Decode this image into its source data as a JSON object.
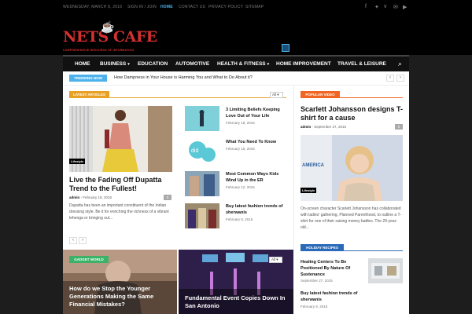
{
  "topbar": {
    "date": "WEDNESDAY, MARCH 8, 2016",
    "links": [
      "SIGN IN / JOIN",
      "HOME",
      "CONTACT US",
      "PRIVACY POLICY",
      "SITEMAP"
    ]
  },
  "header": {
    "logo_text": "NETS CAFE",
    "tagline": "COMPREHENSIVE RESOURCE OF INFORMATION"
  },
  "nav": {
    "items": [
      {
        "label": "HOME",
        "caret": ""
      },
      {
        "label": "BUSINESS",
        "caret": "▾"
      },
      {
        "label": "EDUCATION",
        "caret": ""
      },
      {
        "label": "AUTOMOTIVE",
        "caret": ""
      },
      {
        "label": "HEALTH & FITNESS",
        "caret": "▾"
      },
      {
        "label": "HOME IMPROVEMENT",
        "caret": ""
      },
      {
        "label": "TRAVEL & LEISURE",
        "caret": ""
      }
    ]
  },
  "trending": {
    "label": "TRENDING NOW",
    "text": "How Dampness in Your House is Harming You and What to Do About it?"
  },
  "latest": {
    "label": "LATEST ARTICLES",
    "filter": "All",
    "featured": {
      "category": "Lifestyle",
      "title": "Live the Fading Off Dupatta Trend to the Fullest!",
      "author": "admin",
      "date": "February 18, 2016",
      "comments": "0",
      "excerpt": "Dupatta has been an important constituent of the Indian dressing style. Be it for enriching the richness of a vibrant lehenga or bringing out..."
    },
    "items": [
      {
        "title": "3 Limiting Beliefs Keeping Love Out of Your Life",
        "date": "February 18, 2016"
      },
      {
        "title": "What You Need To Know",
        "date": "February 15, 2016"
      },
      {
        "title": "Most Common Ways Kids Wind Up in the ER",
        "date": "February 12, 2016"
      },
      {
        "title": "Buy latest fashion trends of sherwanis",
        "date": "February 9, 2016"
      }
    ]
  },
  "popular": {
    "label": "POPULAR VIDEO",
    "title": "Scarlett Johansson designs T-shirt for a cause",
    "author": "admin",
    "date": "September 27, 2015",
    "comments": "0",
    "category": "Lifestyle",
    "excerpt": "On-screen character Scarlett Johansson has collaborated with ladies' gathering, Planned Parenthood, to outline a T-shirt for one of their raising money battles. The 29-year-old..."
  },
  "gadget": {
    "label": "GADGET WORLD",
    "filter": "All",
    "tiles": [
      {
        "title": "How do we Stop the Younger Generations Making the Same Financial Mistakes?"
      },
      {
        "title": "Fundamental Event Copies Down In San Antonio"
      }
    ]
  },
  "holiday": {
    "label": "HOLIDAY RECIPES",
    "items": [
      {
        "title": "Healing Centers To Be Positioned By Nature Of Sustenance",
        "date": "September 27, 2015"
      },
      {
        "title": "Buy latest fashion trends of sherwanis",
        "date": "February 9, 2016"
      }
    ]
  }
}
